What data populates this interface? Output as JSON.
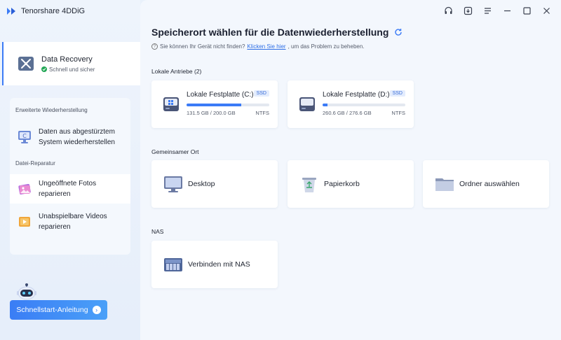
{
  "app": {
    "name": "Tenorshare 4DDiG"
  },
  "sidebar": {
    "recovery": {
      "title": "Data Recovery",
      "subtitle": "Schnell und sicher"
    },
    "advanced_label": "Erweiterte Wiederherstellung",
    "crash_item": {
      "line1": "Daten aus abgestürztem",
      "line2": "System wiederherstellen"
    },
    "repair_label": "Datei-Reparatur",
    "photos_item": {
      "line1": "Ungeöffnete Fotos",
      "line2": "reparieren"
    },
    "videos_item": {
      "line1": "Unabspielbare Videos",
      "line2": "reparieren"
    },
    "quickstart_label": "Schnellstart-Anleitung"
  },
  "main": {
    "title": "Speicherort wählen für die Datenwiederherstellung",
    "help_prefix": "Sie können Ihr Gerät nicht finden?",
    "help_link": "Klicken Sie hier",
    "help_suffix": ", um das Problem zu beheben.",
    "local_label": "Lokale Antriebe (2)",
    "drives": [
      {
        "name": "Lokale Festplatte (C:)",
        "badge": "SSD",
        "size": "131.5 GB / 200.0 GB",
        "fs": "NTFS",
        "used_fraction": 0.66
      },
      {
        "name": "Lokale Festplatte (D:)",
        "badge": "SSD",
        "size": "260.6 GB / 276.6 GB",
        "fs": "NTFS",
        "used_fraction": 0.06
      }
    ],
    "shared_label": "Gemeinsamer Ort",
    "locations": [
      {
        "name": "Desktop",
        "icon": "desktop-icon"
      },
      {
        "name": "Papierkorb",
        "icon": "recycle-bin-icon"
      },
      {
        "name": "Ordner auswählen",
        "icon": "folder-icon"
      }
    ],
    "nas_label": "NAS",
    "nas": {
      "name": "Verbinden mit NAS",
      "icon": "nas-icon"
    }
  },
  "colors": {
    "accent": "#3b7bf6",
    "success": "#22a755",
    "sidebar_bg": "#e9f1fb",
    "main_bg": "#f3f7fd"
  }
}
